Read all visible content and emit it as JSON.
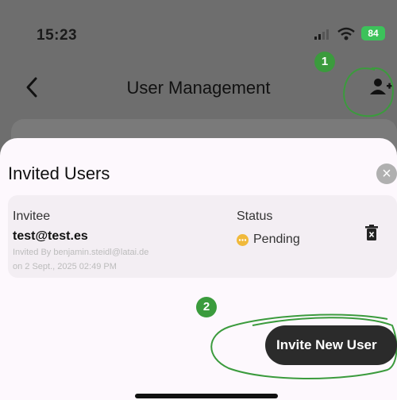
{
  "status_bar": {
    "time": "15:23",
    "battery": "84"
  },
  "header": {
    "title": "User Management",
    "back_icon": "chevron-left-icon",
    "add_icon": "add-user-icon"
  },
  "annotations": {
    "step1": "1",
    "step2": "2",
    "color": "#3b9b3d"
  },
  "sheet": {
    "title": "Invited Users",
    "columns": {
      "invitee": "Invitee",
      "status": "Status"
    },
    "invites": [
      {
        "email": "test@test.es",
        "invited_by": "Invited By benjamin.steidl@latai.de",
        "date": "on 2 Sept., 2025 02:49 PM",
        "status": "Pending",
        "status_color": "#f0b93b"
      }
    ],
    "invite_button": "Invite New User"
  }
}
